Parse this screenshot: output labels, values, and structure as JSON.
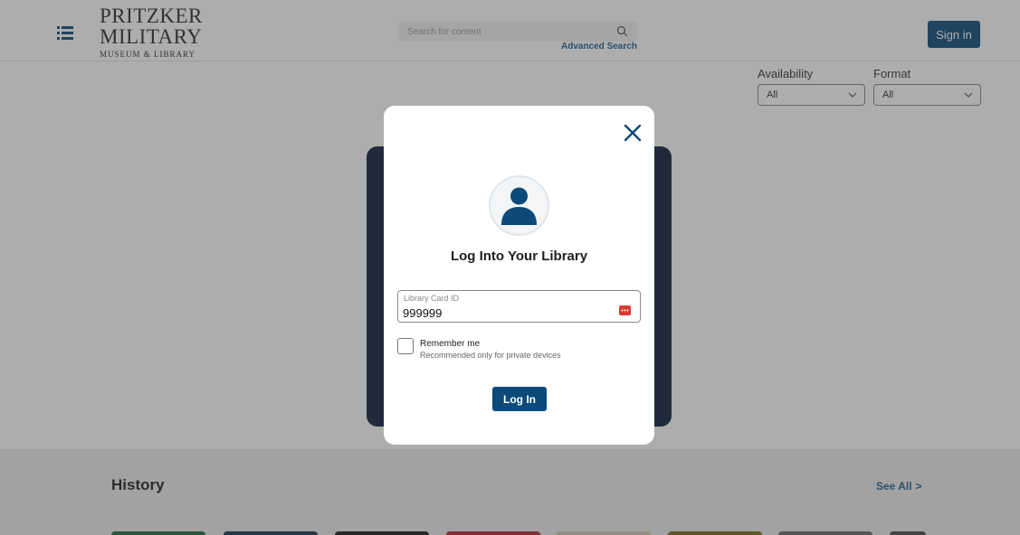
{
  "header": {
    "logo_line1": "PRITZKER",
    "logo_line2": "MILITARY",
    "logo_line3": "MUSEUM & LIBRARY",
    "search_placeholder": "Search for content",
    "advanced_search": "Advanced Search",
    "sign_in": "Sign in"
  },
  "filters": {
    "availability": {
      "label": "Availability",
      "value": "All"
    },
    "format": {
      "label": "Format",
      "value": "All"
    }
  },
  "section": {
    "title": "History",
    "see_all": "See All",
    "see_all_arrow": ">"
  },
  "modal": {
    "title": "Log Into Your Library",
    "card_field_label": "Library Card ID",
    "card_field_value": "999999",
    "remember_label": "Remember me",
    "remember_sub": "Recommended only for private devices",
    "login_button": "Log In"
  },
  "colors": {
    "brand_blue": "#0b4a7a",
    "link_blue": "#1d5e93",
    "hero_navy": "#0b1f3a",
    "password_manager_red": "#d93a32"
  },
  "icons": {
    "menu": "menu-list-icon",
    "search": "search-icon",
    "close": "close-icon",
    "avatar": "user-avatar-icon",
    "password_manager": "password-manager-icon",
    "chevron": "chevron-down-icon"
  }
}
